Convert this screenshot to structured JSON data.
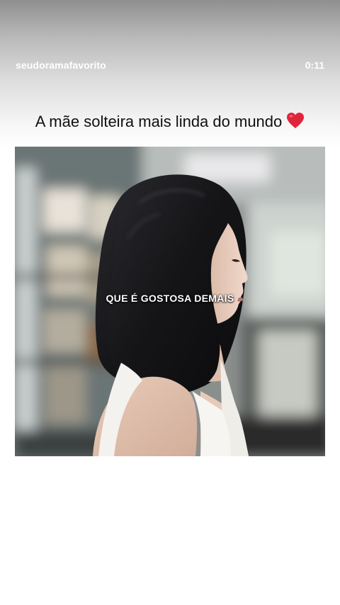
{
  "story": {
    "username": "seudoramafavorito",
    "timer": "0:11",
    "caption": "A mãe solteira mais linda do mundo",
    "caption_emoji": "heart-icon",
    "video_subtitle": "QUE É GOSTOSA DEMAIS"
  },
  "colors": {
    "text_light": "#ffffff",
    "caption_text": "#111111",
    "heart": "#e0243a"
  }
}
